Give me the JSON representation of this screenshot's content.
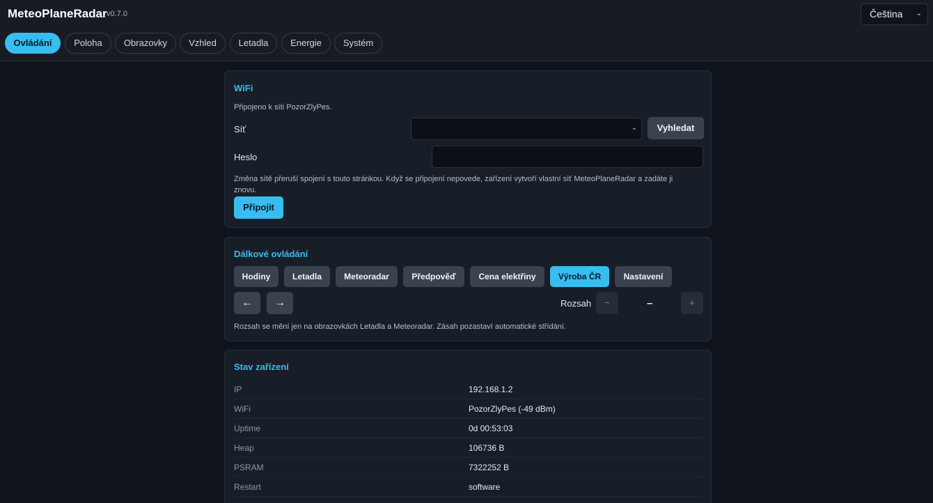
{
  "header": {
    "app_name": "MeteoPlaneRadar",
    "version": "v0.7.0",
    "language": "Čeština"
  },
  "tabs": [
    {
      "label": "Ovládání",
      "active": true
    },
    {
      "label": "Poloha"
    },
    {
      "label": "Obrazovky"
    },
    {
      "label": "Vzhled"
    },
    {
      "label": "Letadla"
    },
    {
      "label": "Energie"
    },
    {
      "label": "Systém"
    }
  ],
  "wifi": {
    "title": "WiFi",
    "status": "Připojeno k síti PozorZlyPes.",
    "network_label": "Síť",
    "network_value": "",
    "scan_button": "Vyhledat",
    "password_label": "Heslo",
    "password_value": "",
    "note": "Změna sítě přeruší spojení s touto stránkou. Když se připojení nepovede, zařízení vytvoří vlastní síť MeteoPlaneRadar a zadáte ji znovu.",
    "connect_button": "Připojit"
  },
  "remote": {
    "title": "Dálkové ovládání",
    "screens": [
      {
        "label": "Hodiny"
      },
      {
        "label": "Letadla"
      },
      {
        "label": "Meteoradar"
      },
      {
        "label": "Předpověď"
      },
      {
        "label": "Cena elektřiny"
      },
      {
        "label": "Výroba ČR",
        "active": true
      },
      {
        "label": "Nastavení"
      }
    ],
    "prev": "←",
    "next": "→",
    "range_label": "Rozsah",
    "range_minus": "−",
    "range_value": "–",
    "range_plus": "+",
    "note": "Rozsah se mění jen na obrazovkách Letadla a Meteoradar. Zásah pozastaví automatické střídání."
  },
  "status": {
    "title": "Stav zařízení",
    "rows": [
      {
        "key": "IP",
        "value": "192.168.1.2"
      },
      {
        "key": "WiFi",
        "value": "PozorZlyPes (-49 dBm)"
      },
      {
        "key": "Uptime",
        "value": "0d 00:53:03"
      },
      {
        "key": "Heap",
        "value": "106736 B"
      },
      {
        "key": "PSRAM",
        "value": "7322252 B"
      },
      {
        "key": "Restart",
        "value": "software"
      }
    ]
  }
}
